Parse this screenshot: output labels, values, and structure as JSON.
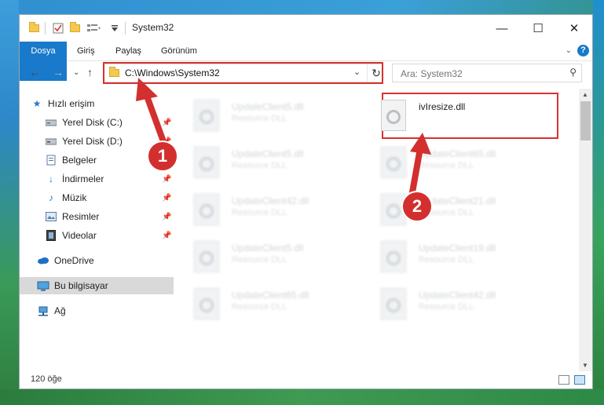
{
  "window": {
    "title": "System32",
    "controls": {
      "minimize": "—",
      "maximize": "☐",
      "close": "✕"
    }
  },
  "ribbon": {
    "tabs": [
      "Dosya",
      "Giriş",
      "Paylaş",
      "Görünüm"
    ],
    "help": "?"
  },
  "address": {
    "path": "C:\\Windows\\System32",
    "search_placeholder": "Ara: System32"
  },
  "sidebar": {
    "items": [
      {
        "label": "Hızlı erişim",
        "icon": "star-icon"
      },
      {
        "label": "Yerel Disk (C:)",
        "icon": "drive-icon",
        "pinned": true
      },
      {
        "label": "Yerel Disk (D:)",
        "icon": "drive-icon",
        "pinned": true
      },
      {
        "label": "Belgeler",
        "icon": "document-icon",
        "pinned": true
      },
      {
        "label": "İndirmeler",
        "icon": "download-icon",
        "pinned": true
      },
      {
        "label": "Müzik",
        "icon": "music-icon",
        "pinned": true
      },
      {
        "label": "Resimler",
        "icon": "picture-icon",
        "pinned": true
      },
      {
        "label": "Videolar",
        "icon": "video-icon",
        "pinned": true
      },
      {
        "label": "OneDrive",
        "icon": "cloud-icon"
      },
      {
        "label": "Bu bilgisayar",
        "icon": "computer-icon",
        "selected": true
      },
      {
        "label": "Ağ",
        "icon": "network-icon"
      }
    ]
  },
  "files": [
    {
      "name": "UpdateClient5.dll",
      "desc": "Resource DLL"
    },
    {
      "name": "ivIresize.dll",
      "desc": ""
    },
    {
      "name": "UpdateClient5.dll",
      "desc": "Resource DLL"
    },
    {
      "name": "UpdateClient65.dll",
      "desc": "Resource DLL"
    },
    {
      "name": "UpdateClient42.dll",
      "desc": "Resource DLL"
    },
    {
      "name": "UpdateClient21.dll",
      "desc": "Resource DLL"
    },
    {
      "name": "UpdateClient5.dll",
      "desc": "Resource DLL"
    },
    {
      "name": "UpdateClient19.dll",
      "desc": "Resource DLL"
    },
    {
      "name": "UpdateClient65.dll",
      "desc": "Resource DLL"
    },
    {
      "name": "UpdateClient42.dll",
      "desc": "Resource DLL"
    }
  ],
  "status": {
    "count": "120 öğe"
  },
  "annotations": {
    "badge1": "1",
    "badge2": "2"
  },
  "colors": {
    "accent": "#1979ca",
    "annotation": "#d9312f"
  }
}
